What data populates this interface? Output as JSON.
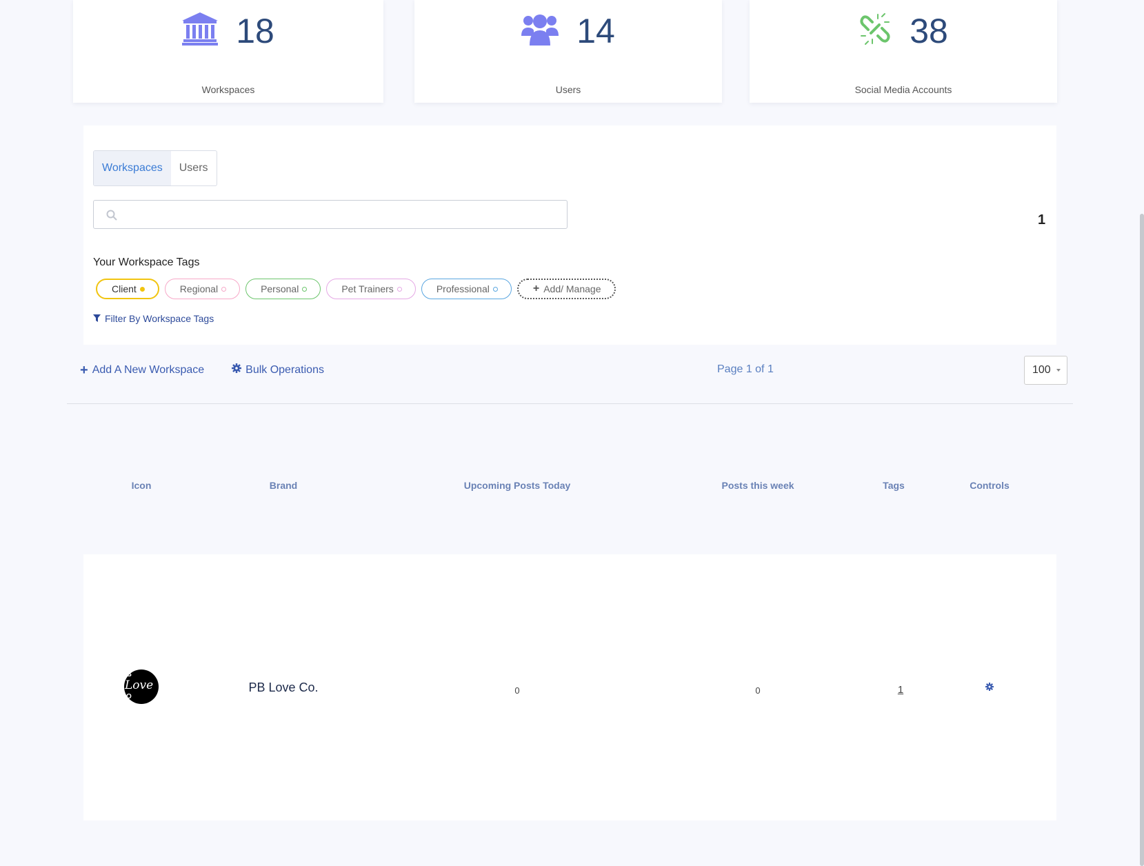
{
  "stats": {
    "workspaces": {
      "count": "18",
      "label": "Workspaces",
      "icon": "bank-icon"
    },
    "users": {
      "count": "14",
      "label": "Users",
      "icon": "users-icon"
    },
    "social": {
      "count": "38",
      "label": "Social Media Accounts",
      "icon": "link-broken-icon"
    }
  },
  "tabs": {
    "workspaces": "Workspaces",
    "users": "Users"
  },
  "search": {
    "placeholder": "",
    "value": ""
  },
  "page_indicator": "1",
  "tags": {
    "title": "Your Workspace Tags",
    "items": [
      {
        "label": "Client",
        "color": "#f1c40f"
      },
      {
        "label": "Regional",
        "color": "#f7a8c8"
      },
      {
        "label": "Personal",
        "color": "#6cc56c"
      },
      {
        "label": "Pet Trainers",
        "color": "#e5a8e5"
      },
      {
        "label": "Professional",
        "color": "#5aa6e0"
      }
    ],
    "add_manage": "Add/ Manage",
    "filter_label": "Filter By Workspace Tags"
  },
  "actions": {
    "add_workspace": "Add A New Workspace",
    "bulk_operations": "Bulk Operations"
  },
  "pagination": {
    "info": "Page 1 of 1",
    "page_size": "100"
  },
  "table": {
    "headers": [
      "Icon",
      "Brand",
      "Upcoming Posts Today",
      "Posts this week",
      "Tags",
      "Controls"
    ],
    "rows": [
      {
        "brand": "PB Love Co.",
        "logo_text": {
          "a": "B",
          "b": "Love",
          "c": "O"
        },
        "upcoming_today": "0",
        "posts_week": "0",
        "tags": "1"
      }
    ]
  },
  "colors": {
    "accent": "#3a7bd5",
    "icon_purple": "#7b7ff0",
    "icon_green": "#6cc56c",
    "number": "#2d4a7a"
  }
}
